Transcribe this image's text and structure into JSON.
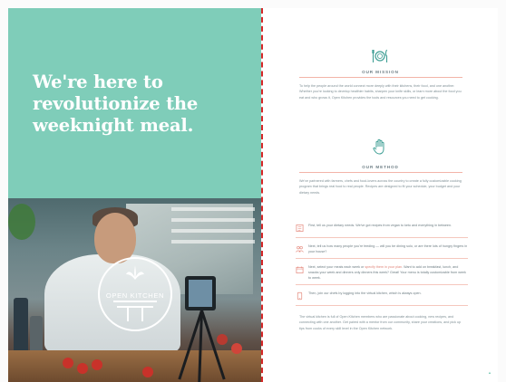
{
  "left_page": {
    "headline": "We're here to revolutionize the weeknight meal.",
    "logo": {
      "text": "OPEN KITCHEN"
    },
    "colors": {
      "hero_background": "#7fcdb9",
      "headline": "#ffffff"
    }
  },
  "right_page": {
    "mission": {
      "icon": "plate-fork-knife-icon",
      "title": "OUR MISSION",
      "body": "To help the people around the world connect more deeply with their kitchens, their food, and one another. Whether you're looking to develop healthier habits, sharpen your knife skills, or learn more about the food you eat and who grows it, Open Kitchen provides the tools and resources you need to get cooking."
    },
    "method": {
      "icon": "hand-stop-icon",
      "title": "OUR METHOD",
      "body": "We've partnered with farmers, chefs and food-lovers across the country to create a fully customizable cooking program that brings real food to real people. Recipes are designed to fit your schedule, your budget and your dietary needs."
    },
    "steps": [
      {
        "icon": "checklist-icon",
        "text": "First, tell us your dietary needs. We've got recipes from vegan to keto and everything in between."
      },
      {
        "icon": "group-icon",
        "text": "Next, tell us how many people you're feeding — will you be dining solo, or are there lots of hungry fingers in your house?"
      },
      {
        "icon": "calendar-icon",
        "text_before": "Next, select your meals each week or ",
        "link": "specify them in your plan",
        "text_after": ". Want to add on breakfast, lunch, and snacks your week and dinners only dinners this week? Great! Your menu is totally customizable from week to week."
      },
      {
        "icon": "phone-icon",
        "text": "Then, join our chefs by logging into the virtual kitchen, which is always open."
      }
    ],
    "closing": "The virtual kitchen is full of Open Kitchen members who are passionate about cooking, new recipes, and connecting with one another. Get paired with a mentor from our community, share your creations, and pick up tips from cooks of every skill level in the Open Kitchen network.",
    "colors": {
      "accent": "#f3b4a8",
      "icon_teal": "#3f9f95",
      "text": "#7f8f95"
    }
  }
}
